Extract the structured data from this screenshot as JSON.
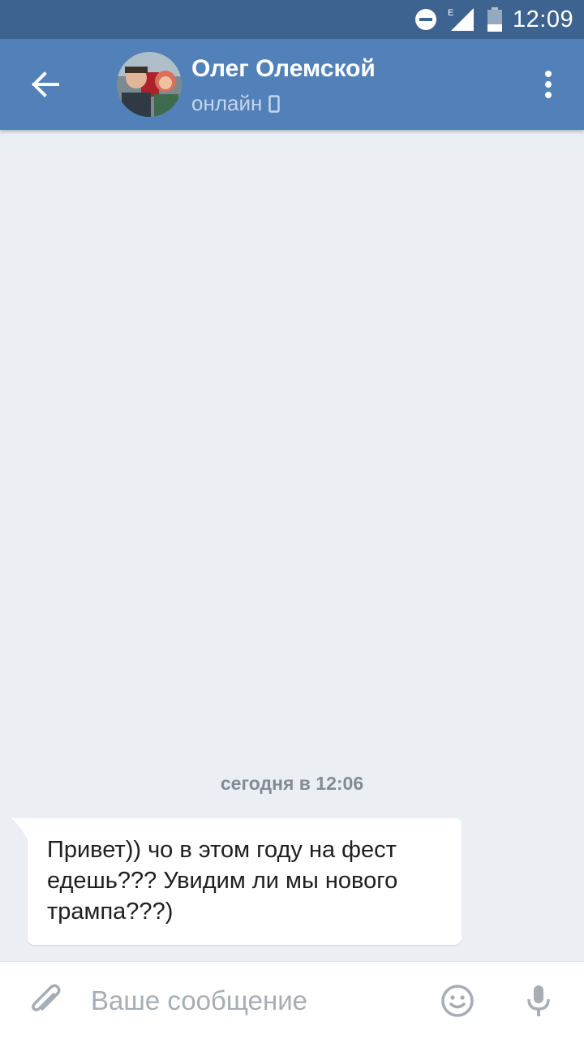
{
  "status_bar": {
    "time": "12:09",
    "network_label": "E",
    "icons": [
      "do-not-disturb-icon",
      "signal-icon",
      "battery-icon"
    ]
  },
  "header": {
    "contact_name": "Олег Олемской",
    "status": "онлайн",
    "status_icon": "phone-icon",
    "colors": {
      "toolbar": "#5181b8",
      "status_bar": "#3d6390"
    }
  },
  "chat": {
    "date_separator": "сегодня в 12:06",
    "messages": [
      {
        "direction": "incoming",
        "text": "Привет)) чо в этом году на фест едешь??? Увидим ли мы нового трампа???)"
      }
    ]
  },
  "composer": {
    "placeholder": "Ваше сообщение",
    "icons": [
      "attach-icon",
      "emoji-icon",
      "microphone-icon"
    ]
  }
}
